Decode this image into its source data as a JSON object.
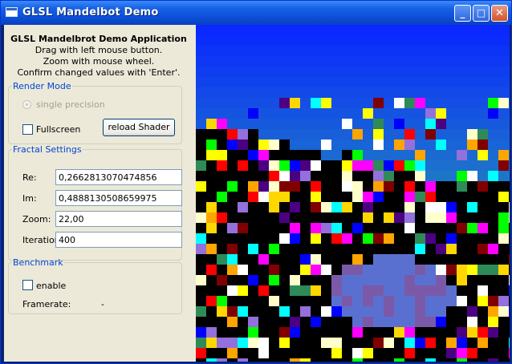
{
  "window": {
    "title": "GLSL Mandelbot Demo"
  },
  "controls": {
    "minimize": "_",
    "maximize": "□",
    "close": "✕"
  },
  "intro": {
    "heading": "GLSL Mandelbrot Demo Application",
    "lines": [
      "Drag with left mouse button.",
      "Zoom with mouse wheel.",
      "Confirm changed values with 'Enter'."
    ]
  },
  "render_mode": {
    "title": "Render Mode",
    "radio_label": "single precision",
    "radio_checked": true,
    "radio_enabled": false,
    "fullscreen_label": "Fullscreen",
    "fullscreen_checked": false,
    "reload_button": "reload Shader"
  },
  "fractal": {
    "title": "Fractal Settings",
    "re_label": "Re:",
    "re_value": "0,2662813070474856",
    "im_label": "Im:",
    "im_value": "0,4888130508659975",
    "zoom_label": "Zoom:",
    "zoom_value": "22,00",
    "iterations_label": "Iterations:",
    "iterations_value": "400"
  },
  "benchmark": {
    "title": "Benchmark",
    "enable_label": "enable",
    "enable_checked": false,
    "framerate_label": "Framerate:",
    "framerate_value": "-"
  },
  "colors": {
    "accent": "#0046d5",
    "titlebar": "#0c4fd6",
    "viewport_background": "#000000"
  }
}
